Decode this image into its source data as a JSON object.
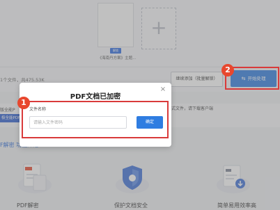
{
  "file": {
    "badge": "解锁",
    "name": "《海南丹方案》主题..."
  },
  "add": {
    "symbol": "+"
  },
  "toolbar": {
    "count_text": "1个文件，共475.53K",
    "continue_label": "继续添加（批量解锁）",
    "start_label": "开始处理",
    "start_icon": "⇆"
  },
  "notice": {
    "left_text": "版全能P",
    "right_text": "式文件，请下载客户端",
    "blue_text": "极全能PDF"
  },
  "section_title": "F解密 功能介绍",
  "features": [
    {
      "label": "PDF解密",
      "icon": "pdf-document-icon"
    },
    {
      "label": "保护文档安全",
      "icon": "shield-icon"
    },
    {
      "label": "简单易用效率高",
      "icon": "download-document-icon"
    }
  ],
  "modal": {
    "title": "PDF文档已加密",
    "close": "×",
    "field_label": "文件名称",
    "placeholder": "请输入文件密码",
    "confirm_label": "确定"
  },
  "annotations": {
    "marker1": "1",
    "marker2": "2",
    "color": "#d93a3a"
  },
  "colors": {
    "accent": "#2f7de1",
    "link": "#2f6ddb"
  }
}
